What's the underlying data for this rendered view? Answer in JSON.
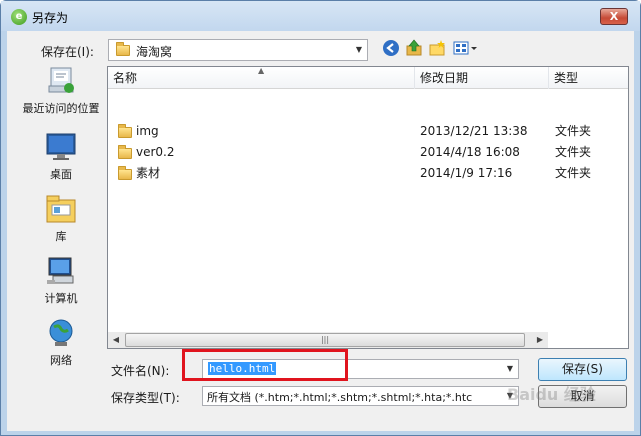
{
  "window": {
    "title": "另存为",
    "close_glyph": "X"
  },
  "save_in": {
    "label": "保存在(I):",
    "value": "海淘窝"
  },
  "places": [
    {
      "label": "最近访问的位置",
      "icon": "recent-places-icon"
    },
    {
      "label": "桌面",
      "icon": "desktop-icon"
    },
    {
      "label": "库",
      "icon": "library-icon"
    },
    {
      "label": "计算机",
      "icon": "computer-icon"
    },
    {
      "label": "网络",
      "icon": "network-icon"
    }
  ],
  "columns": {
    "name": "名称",
    "date": "修改日期",
    "type": "类型"
  },
  "files": [
    {
      "name": "img",
      "date": "2013/12/21 13:38",
      "type": "文件夹"
    },
    {
      "name": "ver0.2",
      "date": "2014/4/18 16:08",
      "type": "文件夹"
    },
    {
      "name": "素材",
      "date": "2014/1/9 17:16",
      "type": "文件夹"
    }
  ],
  "filename": {
    "label": "文件名(N):",
    "value": "hello.html"
  },
  "filetype": {
    "label": "保存类型(T):",
    "value": "所有文档 (*.htm;*.html;*.shtm;*.shtml;*.hta;*.htc"
  },
  "buttons": {
    "save": "保存(S)",
    "cancel": "取消"
  },
  "watermark": "Baidu 经验"
}
